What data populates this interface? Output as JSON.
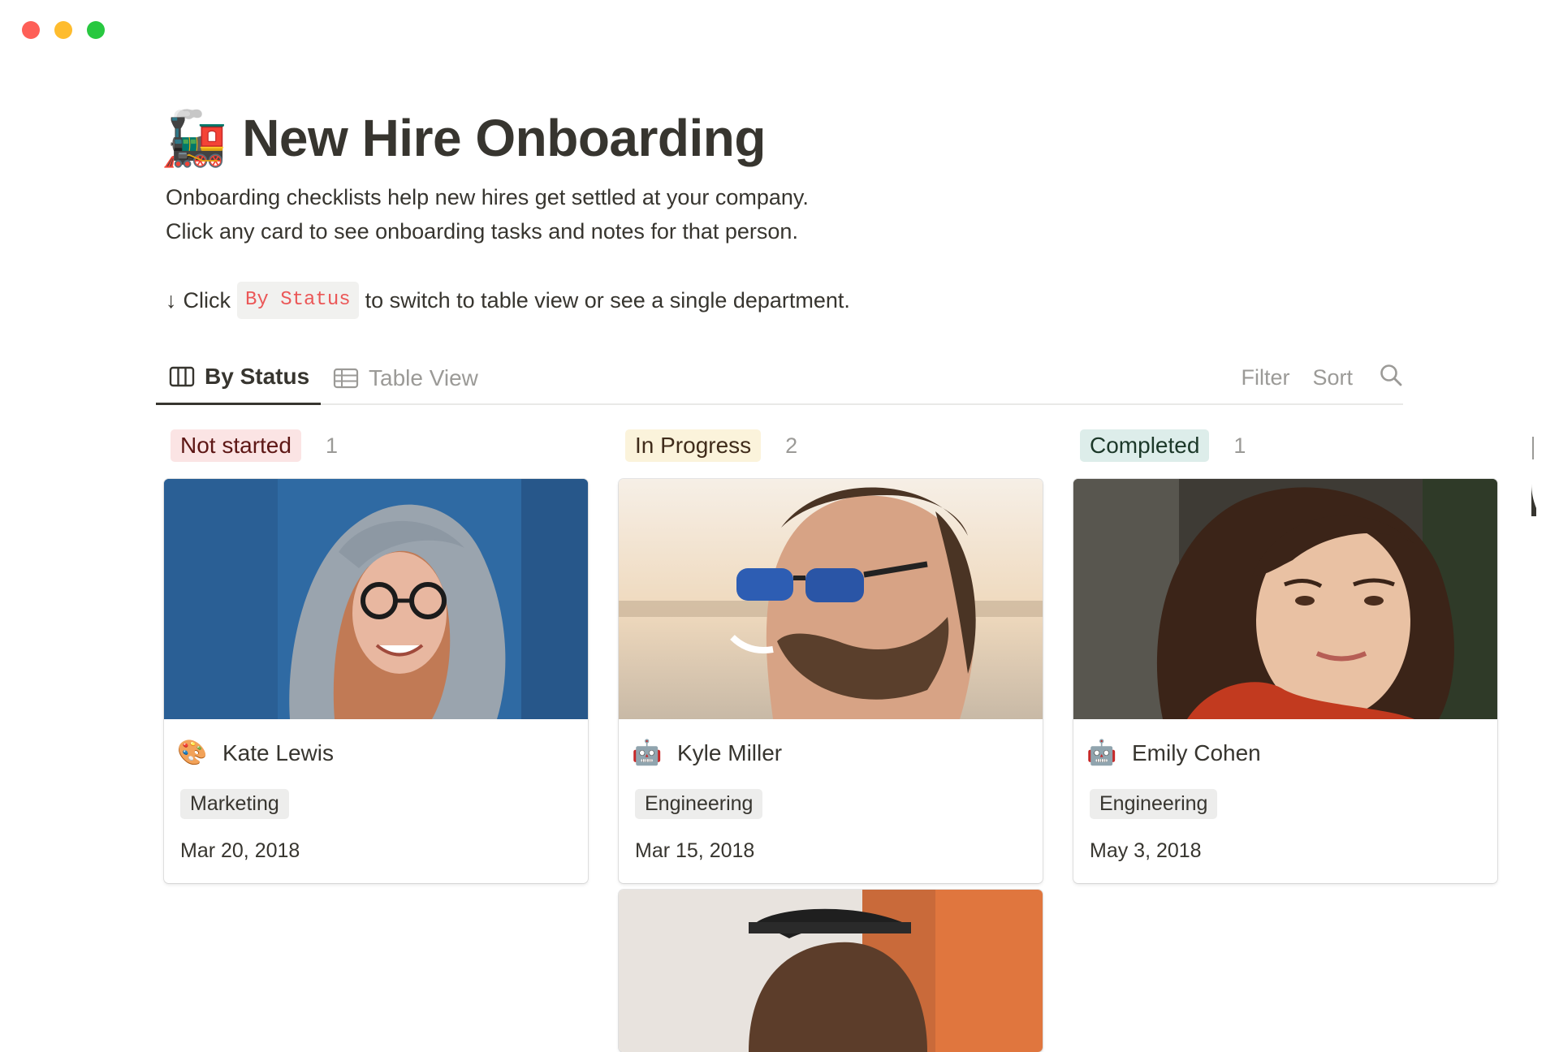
{
  "page": {
    "icon": "steam-locomotive-emoji",
    "title": "New Hire Onboarding",
    "description_lines": [
      "Onboarding checklists help new hires get settled at your company.",
      "Click any card to see onboarding tasks and notes for that person."
    ],
    "hint": {
      "arrow": "↓",
      "prefix": "Click",
      "code": "By Status",
      "suffix": "to switch to table view or see a single department."
    }
  },
  "views": {
    "tabs": [
      {
        "label": "By Status",
        "icon": "board-icon",
        "active": true
      },
      {
        "label": "Table View",
        "icon": "table-icon",
        "active": false
      }
    ],
    "tools": {
      "filter": "Filter",
      "sort": "Sort",
      "search_icon": "search-icon"
    }
  },
  "board": {
    "columns": [
      {
        "status": "Not started",
        "count": "1",
        "pill_bg": "#fbe4e4",
        "pill_color": "#5d1715",
        "cards": [
          {
            "emoji": "🎨",
            "name": "Kate Lewis",
            "department": "Marketing",
            "date": "Mar 20, 2018"
          }
        ]
      },
      {
        "status": "In Progress",
        "count": "2",
        "pill_bg": "#fbf3db",
        "pill_color": "#402c1b",
        "cards": [
          {
            "emoji": "🤖",
            "name": "Kyle Miller",
            "department": "Engineering",
            "date": "Mar 15, 2018"
          }
        ]
      },
      {
        "status": "Completed",
        "count": "1",
        "pill_bg": "#ddedea",
        "pill_color": "#1c3829",
        "cards": [
          {
            "emoji": "🤖",
            "name": "Emily Cohen",
            "department": "Engineering",
            "date": "May 3, 2018"
          }
        ]
      }
    ]
  },
  "colors": {
    "text": "#37352f",
    "muted": "#9b9a97",
    "code_red": "#eb5757",
    "tag_bg": "#ededec"
  }
}
